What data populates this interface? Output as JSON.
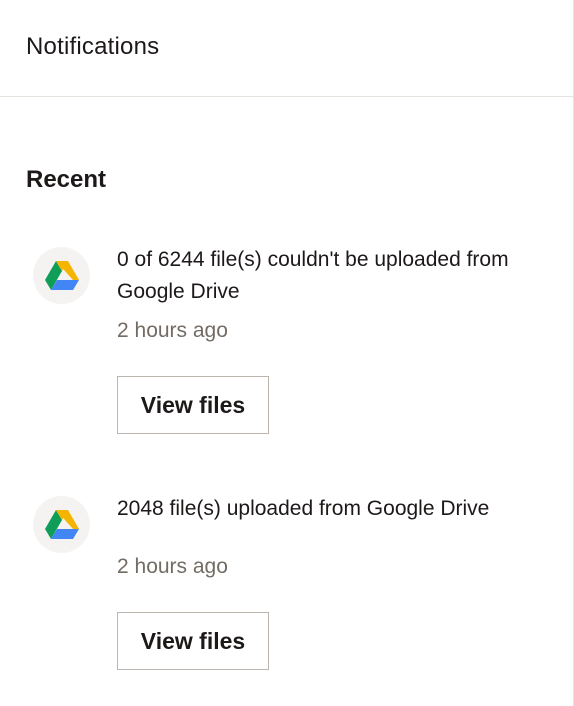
{
  "header": {
    "title": "Notifications"
  },
  "section": {
    "title": "Recent"
  },
  "notifications": [
    {
      "icon": "google-drive-icon",
      "text": "0 of 6244 file(s) couldn't be uploaded from Google Drive",
      "time": "2 hours ago",
      "button_label": "View files"
    },
    {
      "icon": "google-drive-icon",
      "text": "2048 file(s) uploaded from Google Drive",
      "time": "2 hours ago",
      "button_label": "View files"
    }
  ],
  "colors": {
    "text": "#1e1919",
    "muted": "#736c64",
    "border": "#e6e3df",
    "drive_green": "#0f9d58",
    "drive_yellow": "#f4b400",
    "drive_blue": "#4285f4"
  }
}
